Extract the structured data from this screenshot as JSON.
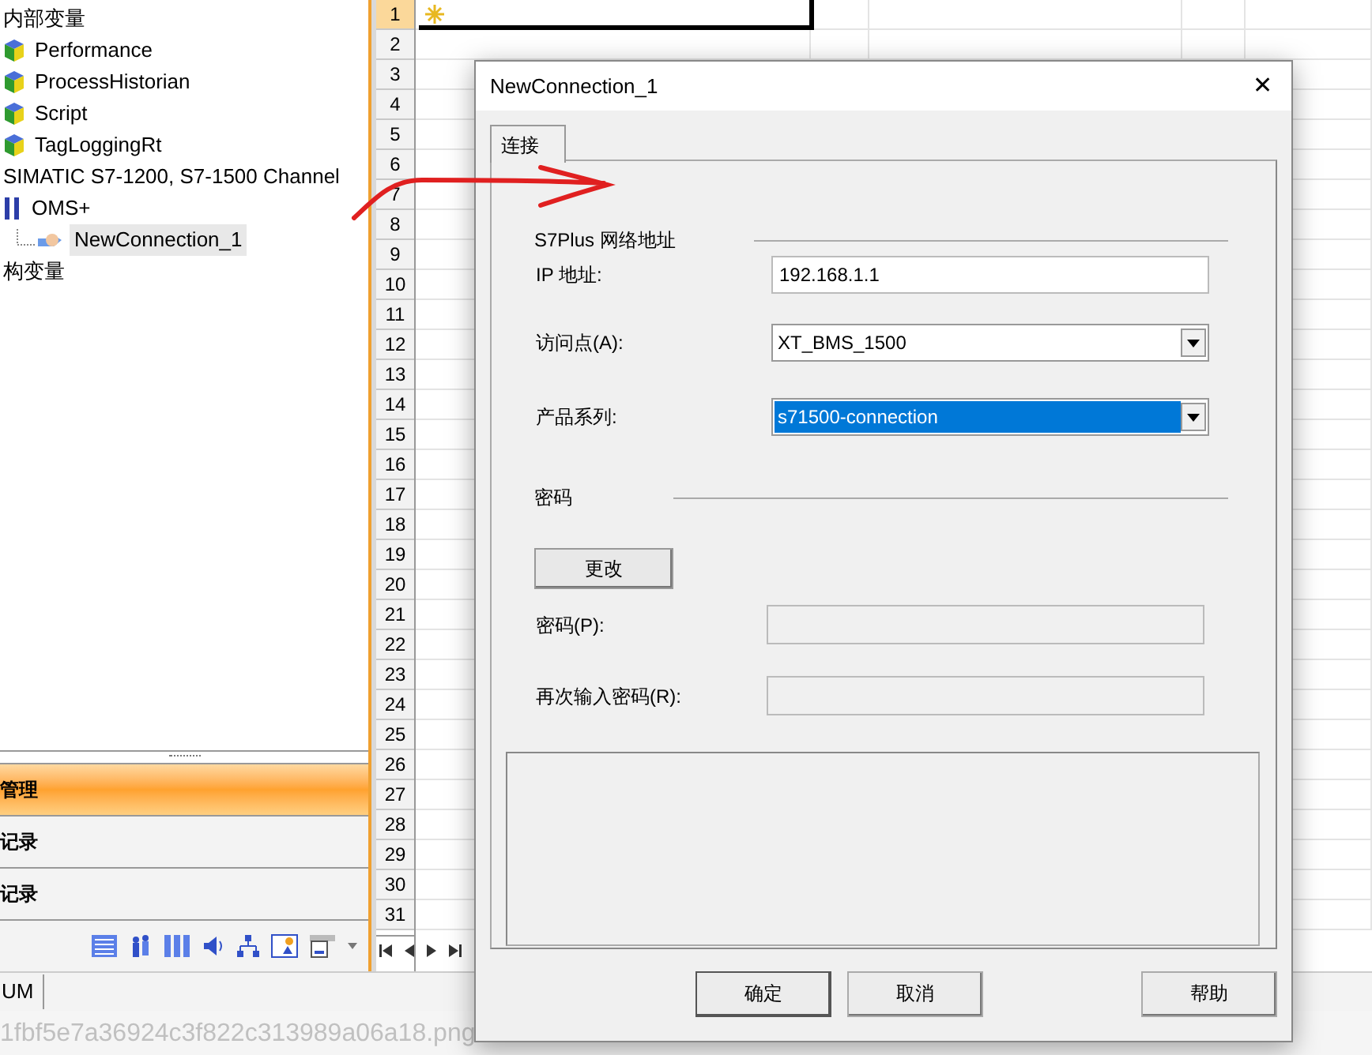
{
  "tree": {
    "heading": "内部变量",
    "items": [
      {
        "label": "Performance",
        "kind": "tag"
      },
      {
        "label": "ProcessHistorian",
        "kind": "tag"
      },
      {
        "label": "Script",
        "kind": "tag"
      },
      {
        "label": "TagLoggingRt",
        "kind": "tag"
      },
      {
        "label": "SIMATIC S7-1200, S7-1500 Channel",
        "kind": "channel"
      },
      {
        "label": "OMS+",
        "kind": "driver",
        "children": [
          {
            "label": "NewConnection_1",
            "kind": "connection",
            "selected": true
          }
        ]
      },
      {
        "label": "构变量",
        "kind": "plain"
      }
    ]
  },
  "nav_sections": [
    {
      "label": "管理",
      "selected": true
    },
    {
      "label": "记录",
      "selected": false
    },
    {
      "label": "记录",
      "selected": false
    }
  ],
  "status_bar": {
    "text": "UM"
  },
  "background_text": [
    "1fbf5e7a36924c3f822c313989a06a18.png"
  ],
  "grid": {
    "rows": [
      {
        "number": "1",
        "selected": true
      },
      {
        "number": "2",
        "selected": false
      },
      {
        "number": "3",
        "selected": false
      },
      {
        "number": "4",
        "selected": false
      },
      {
        "number": "5",
        "selected": false
      },
      {
        "number": "6",
        "selected": false
      },
      {
        "number": "7",
        "selected": false
      },
      {
        "number": "8",
        "selected": false
      },
      {
        "number": "9",
        "selected": false
      },
      {
        "number": "10",
        "selected": false
      },
      {
        "number": "11",
        "selected": false
      },
      {
        "number": "12",
        "selected": false
      },
      {
        "number": "13",
        "selected": false
      },
      {
        "number": "14",
        "selected": false
      },
      {
        "number": "15",
        "selected": false
      },
      {
        "number": "16",
        "selected": false
      },
      {
        "number": "17",
        "selected": false
      },
      {
        "number": "18",
        "selected": false
      },
      {
        "number": "19",
        "selected": false
      },
      {
        "number": "20",
        "selected": false
      },
      {
        "number": "21",
        "selected": false
      },
      {
        "number": "22",
        "selected": false
      },
      {
        "number": "23",
        "selected": false
      },
      {
        "number": "24",
        "selected": false
      },
      {
        "number": "25",
        "selected": false
      },
      {
        "number": "26",
        "selected": false
      },
      {
        "number": "27",
        "selected": false
      },
      {
        "number": "28",
        "selected": false
      },
      {
        "number": "29",
        "selected": false
      },
      {
        "number": "30",
        "selected": false
      },
      {
        "number": "31",
        "selected": false
      }
    ]
  },
  "dialog": {
    "title": "NewConnection_1",
    "close": "✕",
    "tabs": [
      {
        "label": "连接",
        "selected": true
      }
    ],
    "address_group": "S7Plus 网络地址",
    "fields": [
      {
        "label": "IP 地址:",
        "kind": "text",
        "value": "192.168.1.1"
      },
      {
        "label": "访问点(A):",
        "kind": "combo",
        "value": "XT_BMS_1500",
        "focused": false
      },
      {
        "label": "产品系列:",
        "kind": "combo",
        "value": "s71500-connection",
        "focused": true
      }
    ],
    "password_group": "密码",
    "change_button": "更改",
    "password_fields": [
      {
        "label": "密码(P):",
        "disabled": true
      },
      {
        "label": "再次输入密码(R):",
        "disabled": true
      }
    ],
    "buttons": [
      {
        "label": "确定",
        "default": true
      },
      {
        "label": "取消",
        "default": false
      },
      {
        "label": "帮助",
        "default": false
      }
    ]
  }
}
